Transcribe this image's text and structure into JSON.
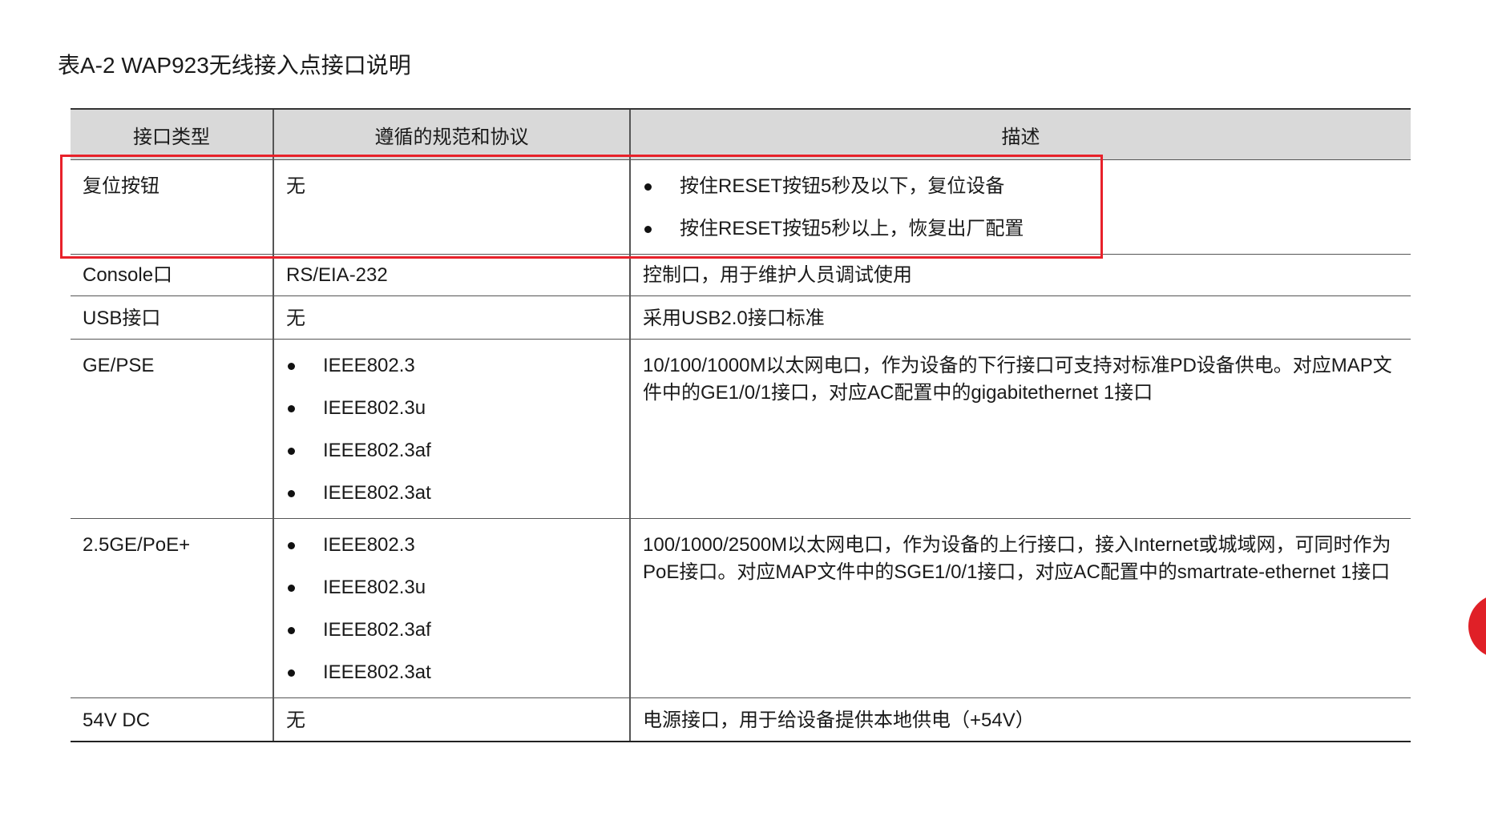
{
  "caption": "表A-2 WAP923无线接入点接口说明",
  "table": {
    "headers": [
      "接口类型",
      "遵循的规范和协议",
      "描述"
    ],
    "rows": [
      {
        "type": "复位按钮",
        "standard": "无",
        "description_items": [
          "按住RESET按钮5秒及以下，复位设备",
          "按住RESET按钮5秒以上，恢复出厂配置"
        ]
      },
      {
        "type": "Console口",
        "standard": "RS/EIA-232",
        "description": "控制口，用于维护人员调试使用"
      },
      {
        "type": "USB接口",
        "standard": "无",
        "description": "采用USB2.0接口标准"
      },
      {
        "type": "GE/PSE",
        "standard_items": [
          "IEEE802.3",
          "IEEE802.3u",
          "IEEE802.3af",
          "IEEE802.3at"
        ],
        "description_lines": [
          "10/100/1000M以太网电口，作为设备的下行接口可支持对标准PD设备供电。对应MAP文",
          "件中的GE1/0/1接口，对应AC配置中的gigabitethernet 1接口"
        ]
      },
      {
        "type": "2.5GE/PoE+",
        "standard_items": [
          "IEEE802.3",
          "IEEE802.3u",
          "IEEE802.3af",
          "IEEE802.3at"
        ],
        "description_lines": [
          "100/1000/2500M以太网电口，作为设备的上行接口，接入Internet或城域网，可同时作为",
          "PoE接口。对应MAP文件中的SGE1/0/1接口，对应AC配置中的smartrate-ethernet 1接口"
        ]
      },
      {
        "type": "54V DC",
        "standard": "无",
        "description": "电源接口，用于给设备提供本地供电（+54V）"
      }
    ]
  },
  "highlight_color": "#e8212a",
  "badge_color": "#e02027"
}
